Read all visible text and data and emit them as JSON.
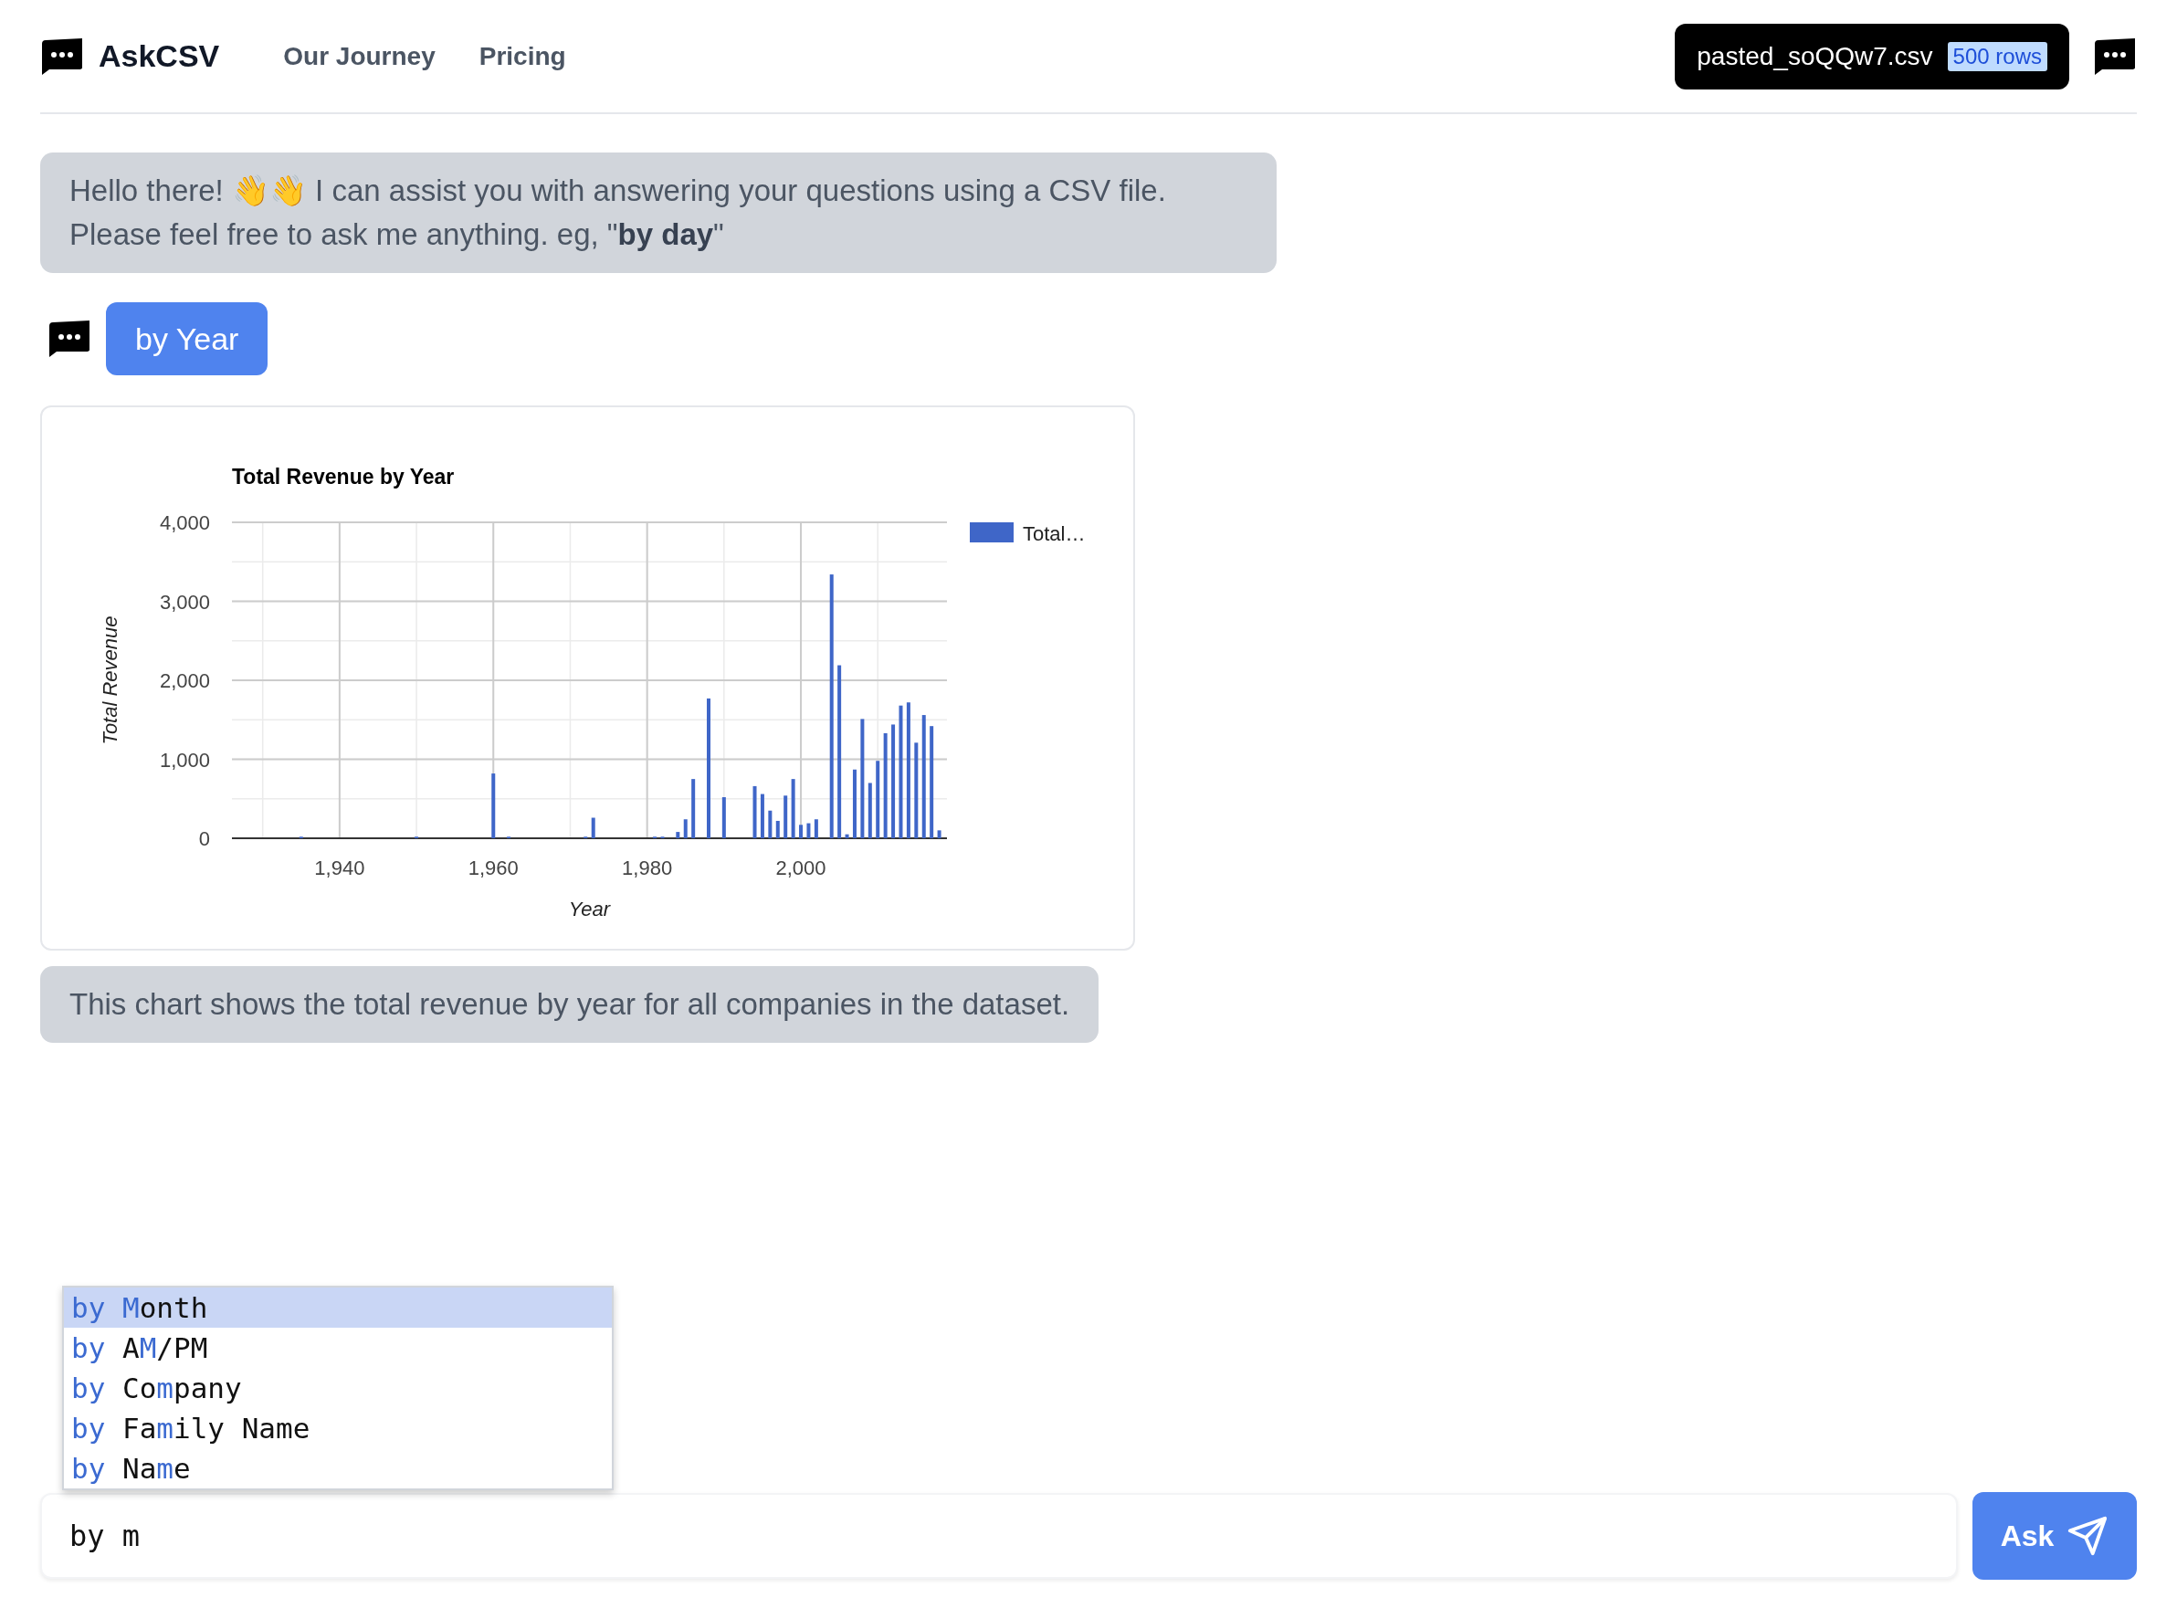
{
  "header": {
    "brand": "AskCSV",
    "nav": [
      {
        "label": "Our Journey"
      },
      {
        "label": "Pricing"
      }
    ],
    "file": {
      "name": "pasted_soQQw7.csv",
      "rows": "500 rows"
    }
  },
  "messages": [
    {
      "kind": "bot",
      "text": "Hello there! 👋👋 I can assist you with answering your questions using a CSV file. Please feel free to ask me anything. eg, \"**by day**\""
    },
    {
      "kind": "user",
      "text": "by Year"
    },
    {
      "kind": "chart",
      "chart_data": {
        "type": "bar",
        "title": "Total Revenue by Year",
        "xlabel": "Year",
        "ylabel": "Total Revenue",
        "x": [
          1935,
          1950,
          1960,
          1962,
          1972,
          1973,
          1981,
          1982,
          1984,
          1985,
          1986,
          1988,
          1990,
          1994,
          1995,
          1996,
          1997,
          1998,
          1999,
          2000,
          2001,
          2002,
          2004,
          2005,
          2006,
          2007,
          2008,
          2009,
          2010,
          2011,
          2012,
          2013,
          2014,
          2015,
          2016,
          2017,
          2018
        ],
        "series": [
          {
            "name": "Total…",
            "color": "#3f66c8",
            "values": [
              20,
              20,
              820,
              20,
              20,
              260,
              20,
              20,
              80,
              240,
              750,
              1770,
              520,
              660,
              560,
              350,
              220,
              540,
              750,
              170,
              190,
              240,
              3340,
              2190,
              50,
              870,
              1510,
              700,
              980,
              1330,
              1440,
              1680,
              1720,
              1210,
              1560,
              1420,
              100
            ]
          }
        ],
        "xlim": [
          1926,
          2019
        ],
        "ylim": [
          0,
          4000
        ],
        "grid": true,
        "xticks": [
          {
            "value": 1940,
            "label": "1,940"
          },
          {
            "value": 1960,
            "label": "1,960"
          },
          {
            "value": 1980,
            "label": "1,980"
          },
          {
            "value": 2000,
            "label": "2,000"
          }
        ],
        "yticks": [
          {
            "value": 0,
            "label": "0"
          },
          {
            "value": 1000,
            "label": "1,000"
          },
          {
            "value": 2000,
            "label": "2,000"
          },
          {
            "value": 3000,
            "label": "3,000"
          },
          {
            "value": 4000,
            "label": "4,000"
          }
        ]
      }
    },
    {
      "kind": "bot",
      "text": "This chart shows the total revenue by year for all companies in the dataset."
    }
  ],
  "autocomplete": [
    {
      "selected": true,
      "parts": [
        {
          "text": "by ",
          "match": true
        },
        {
          "text": "M",
          "match": true
        },
        {
          "text": "onth",
          "match": false
        }
      ]
    },
    {
      "selected": false,
      "parts": [
        {
          "text": "by ",
          "match": true
        },
        {
          "text": "A",
          "match": false
        },
        {
          "text": "M",
          "match": true
        },
        {
          "text": "/PM",
          "match": false
        }
      ]
    },
    {
      "selected": false,
      "parts": [
        {
          "text": "by ",
          "match": true
        },
        {
          "text": "Co",
          "match": false
        },
        {
          "text": "m",
          "match": true
        },
        {
          "text": "pany",
          "match": false
        }
      ]
    },
    {
      "selected": false,
      "parts": [
        {
          "text": "by ",
          "match": true
        },
        {
          "text": "Fa",
          "match": false
        },
        {
          "text": "m",
          "match": true
        },
        {
          "text": "ily Name",
          "match": false
        }
      ]
    },
    {
      "selected": false,
      "parts": [
        {
          "text": "by ",
          "match": true
        },
        {
          "text": "Na",
          "match": false
        },
        {
          "text": "m",
          "match": true
        },
        {
          "text": "e",
          "match": false
        }
      ]
    }
  ],
  "input": {
    "value": "by m"
  },
  "ask_button": {
    "label": "Ask"
  }
}
